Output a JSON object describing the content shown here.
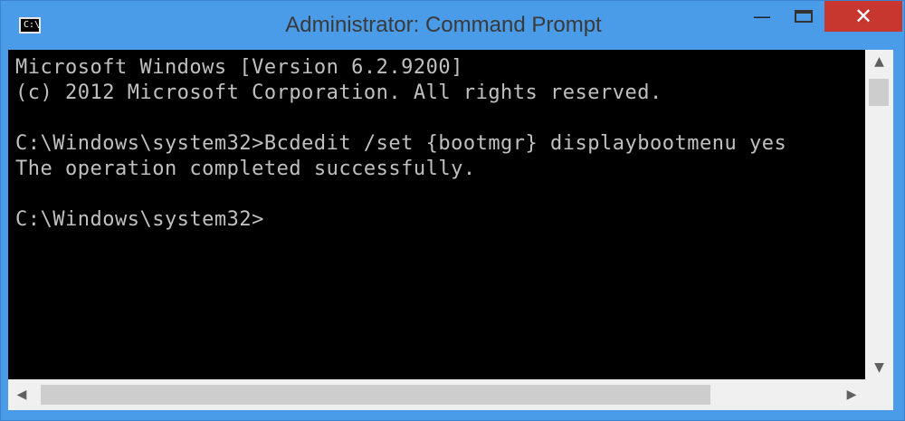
{
  "window": {
    "title": "Administrator: Command Prompt",
    "icon": "cmd-icon",
    "icon_glyph": "C:\\",
    "controls": {
      "minimize": "—",
      "close": "✕"
    }
  },
  "console": {
    "lines": [
      "Microsoft Windows [Version 6.2.9200]",
      "(c) 2012 Microsoft Corporation. All rights reserved.",
      "",
      "C:\\Windows\\system32>Bcdedit /set {bootmgr} displaybootmenu yes",
      "The operation completed successfully.",
      "",
      "C:\\Windows\\system32>"
    ]
  },
  "scrollbars": {
    "up_arrow": "▲",
    "down_arrow": "▼",
    "left_arrow": "◀",
    "right_arrow": "▶"
  },
  "colors": {
    "frame": "#4a9be8",
    "close": "#c7372f",
    "console_bg": "#000000",
    "console_fg": "#c0c0c0"
  }
}
